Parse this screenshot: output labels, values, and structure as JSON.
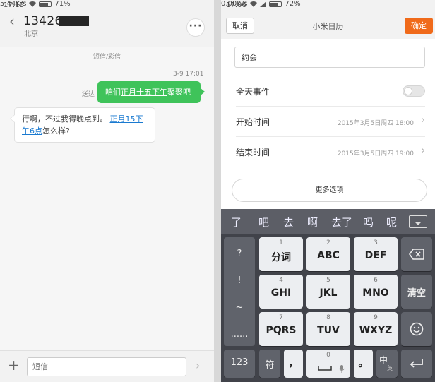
{
  "sms": {
    "status": {
      "time": "17:15",
      "speed": "5.44K/s",
      "battery": "71%",
      "battery_level": 0.71
    },
    "contact": {
      "number": "134262",
      "location": "北京"
    },
    "more_label": "···",
    "message_type": "短信/彩信",
    "sent_time": "3-9 17:01",
    "sent_status": "送达",
    "sent_message": {
      "part1": "咱们",
      "link": "正月十五下午",
      "part2": "聚聚吧"
    },
    "received_message": {
      "part1": "行啊，不过我得晚点到。",
      "link1": "正月15下",
      "link2": "午6点",
      "part2": "怎么样?"
    },
    "composer": {
      "placeholder": "短信"
    }
  },
  "calendar": {
    "status": {
      "time": "17:06",
      "speed": "0.00K/s",
      "battery": "72%",
      "battery_level": 0.72
    },
    "cancel_label": "取消",
    "title": "小米日历",
    "confirm_label": "确定",
    "event_title": "约会",
    "all_day": {
      "label": "全天事件",
      "on": false
    },
    "start": {
      "label": "开始时间",
      "value": "2015年3月5日周四 18:00"
    },
    "end": {
      "label": "结束时间",
      "value": "2015年3月5日周四 19:00"
    },
    "more_options": "更多选项",
    "accent_color": "#f06a1a"
  },
  "keyboard": {
    "candidates": [
      "了",
      "吧",
      "去",
      "啊",
      "去了",
      "吗",
      "呢"
    ],
    "side_keys": [
      "?",
      "!",
      "~",
      "......"
    ],
    "keys": [
      {
        "num": "1",
        "label": "分词"
      },
      {
        "num": "2",
        "label": "ABC"
      },
      {
        "num": "3",
        "label": "DEF"
      },
      {
        "num": "4",
        "label": "GHI"
      },
      {
        "num": "5",
        "label": "JKL"
      },
      {
        "num": "6",
        "label": "MNO"
      },
      {
        "num": "7",
        "label": "PQRS"
      },
      {
        "num": "8",
        "label": "TUV"
      },
      {
        "num": "9",
        "label": "WXYZ"
      }
    ],
    "clear_label": "清空",
    "bottom": {
      "num_switch": "123",
      "symbol": "符",
      "comma": "，",
      "zero": "0",
      "period": "。",
      "lang_main": "中",
      "lang_sub": "英"
    }
  }
}
